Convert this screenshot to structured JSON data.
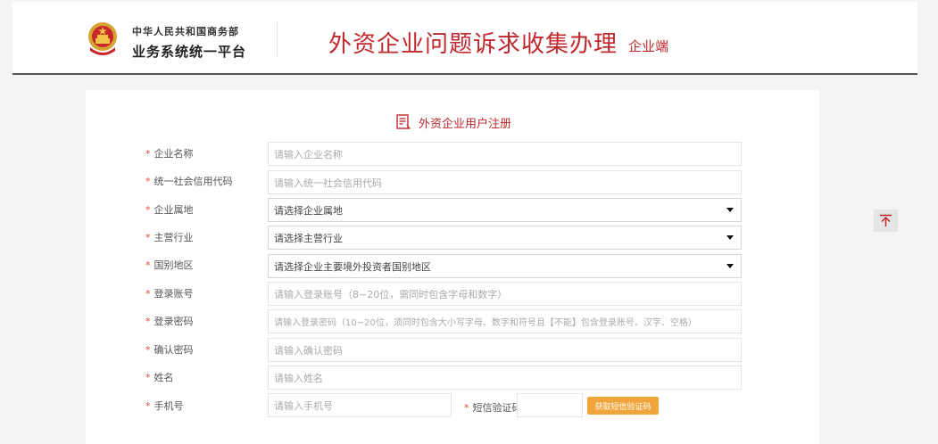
{
  "header": {
    "org_line1": "中华人民共和国商务部",
    "org_line2": "业务系统统一平台",
    "system_title": "外资企业问题诉求收集办理",
    "system_sub": "企业端"
  },
  "form": {
    "heading": "外资企业用户注册",
    "required_mark": "*",
    "fields": [
      {
        "label": "企业名称",
        "placeholder": "请输入企业名称",
        "kind": "input"
      },
      {
        "label": "统一社会信用代码",
        "placeholder": "请输入统一社会信用代码",
        "kind": "input"
      },
      {
        "label": "企业属地",
        "value": "请选择企业属地",
        "kind": "select"
      },
      {
        "label": "主营行业",
        "value": "请选择主营行业",
        "kind": "select"
      },
      {
        "label": "国别地区",
        "value": "请选择企业主要境外投资者国别地区",
        "kind": "select"
      },
      {
        "label": "登录账号",
        "placeholder": "请输入登录账号（8~20位，需同时包含字母和数字）",
        "kind": "input"
      },
      {
        "label": "登录密码",
        "placeholder": "请输入登录密码（10~20位，须同时包含大小写字母、数字和符号且【不能】包含登录账号、汉字、空格）",
        "kind": "input"
      },
      {
        "label": "确认密码",
        "placeholder": "请输入确认密码",
        "kind": "input"
      },
      {
        "label": "姓名",
        "placeholder": "请输入姓名",
        "kind": "input"
      }
    ],
    "phone": {
      "label": "手机号",
      "placeholder": "请输入手机号"
    },
    "sms": {
      "label": "短信验证码",
      "button": "获取短信验证码"
    }
  },
  "colors": {
    "brand_red": "#c0282d",
    "button_orange": "#f0a43a"
  },
  "icons": {
    "heading_icon": "form-document-icon",
    "scroll_top": "back-to-top-icon",
    "emblem": "national-emblem"
  }
}
